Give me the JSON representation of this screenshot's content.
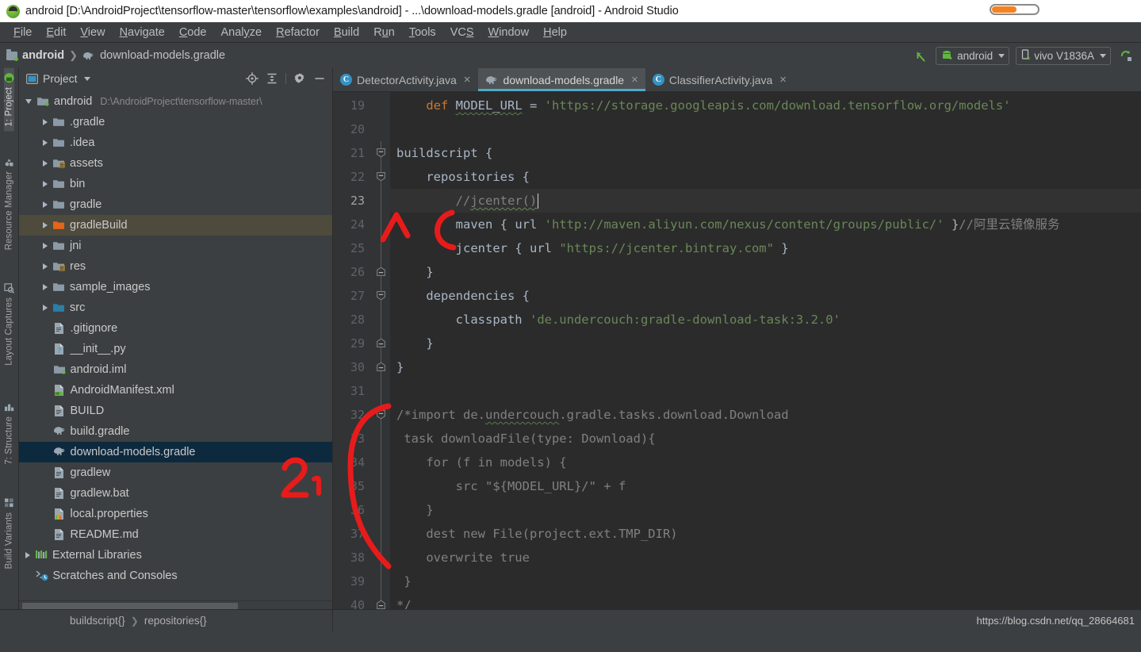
{
  "window": {
    "title": "android [D:\\AndroidProject\\tensorflow-master\\tensorflow\\examples\\android] - ...\\download-models.gradle [android] - Android Studio",
    "app_icon": "android-robot-icon",
    "progress_percent": 55
  },
  "menubar": {
    "items": [
      {
        "label": "File",
        "mnemonic": "F"
      },
      {
        "label": "Edit",
        "mnemonic": "E"
      },
      {
        "label": "View",
        "mnemonic": "V"
      },
      {
        "label": "Navigate",
        "mnemonic": "N"
      },
      {
        "label": "Code",
        "mnemonic": "C"
      },
      {
        "label": "Analyze",
        "mnemonic": "y"
      },
      {
        "label": "Refactor",
        "mnemonic": "R"
      },
      {
        "label": "Build",
        "mnemonic": "B"
      },
      {
        "label": "Run",
        "mnemonic": "u"
      },
      {
        "label": "Tools",
        "mnemonic": "T"
      },
      {
        "label": "VCS",
        "mnemonic": "S"
      },
      {
        "label": "Window",
        "mnemonic": "W"
      },
      {
        "label": "Help",
        "mnemonic": "H"
      }
    ]
  },
  "navbar": {
    "breadcrumbs": [
      {
        "label": "android",
        "icon": "module-folder-icon"
      },
      {
        "label": "download-models.gradle",
        "icon": "gradle-elephant-icon"
      }
    ],
    "run_config": {
      "label": "android",
      "icon": "android-robot-icon"
    },
    "device": {
      "label": "vivo V1836A",
      "icon": "phone-icon"
    },
    "back_arrow_icon": "back-arrow-icon",
    "sync_icon": "gradle-sync-icon"
  },
  "left_tool_strip": {
    "tabs": [
      {
        "label": "1: Project",
        "icon": "project-icon",
        "active": true
      },
      {
        "label": "Resource Manager",
        "icon": "resource-manager-icon",
        "active": false
      },
      {
        "label": "Layout Captures",
        "icon": "layout-captures-icon",
        "active": false
      },
      {
        "label": "7: Structure",
        "icon": "structure-icon",
        "active": false
      },
      {
        "label": "Build Variants",
        "icon": "build-variants-icon",
        "active": false
      }
    ]
  },
  "project_panel": {
    "title": "Project",
    "view_icon": "project-view-icon",
    "dropdown_icon": "chevron-down-icon",
    "actions": [
      {
        "name": "locate-icon"
      },
      {
        "name": "collapse-all-icon"
      },
      {
        "name": "gear-icon"
      },
      {
        "name": "minimize-icon"
      }
    ],
    "tree": [
      {
        "label": "android",
        "path": "D:\\AndroidProject\\tensorflow-master\\",
        "indent": 0,
        "arrow": "down",
        "icon": "module-folder-icon",
        "state": "normal"
      },
      {
        "label": ".gradle",
        "indent": 1,
        "arrow": "right",
        "icon": "folder-icon",
        "state": "normal"
      },
      {
        "label": ".idea",
        "indent": 1,
        "arrow": "right",
        "icon": "folder-icon",
        "state": "normal"
      },
      {
        "label": "assets",
        "indent": 1,
        "arrow": "right",
        "icon": "resource-folder-icon",
        "state": "normal"
      },
      {
        "label": "bin",
        "indent": 1,
        "arrow": "right",
        "icon": "folder-icon",
        "state": "normal"
      },
      {
        "label": "gradle",
        "indent": 1,
        "arrow": "right",
        "icon": "folder-icon",
        "state": "normal"
      },
      {
        "label": "gradleBuild",
        "indent": 1,
        "arrow": "right",
        "icon": "excluded-folder-icon",
        "state": "highlighted"
      },
      {
        "label": "jni",
        "indent": 1,
        "arrow": "right",
        "icon": "folder-icon",
        "state": "normal"
      },
      {
        "label": "res",
        "indent": 1,
        "arrow": "right",
        "icon": "resource-folder-icon",
        "state": "normal"
      },
      {
        "label": "sample_images",
        "indent": 1,
        "arrow": "right",
        "icon": "folder-icon",
        "state": "normal"
      },
      {
        "label": "src",
        "indent": 1,
        "arrow": "right",
        "icon": "source-folder-icon",
        "state": "normal"
      },
      {
        "label": ".gitignore",
        "indent": 1,
        "arrow": "none",
        "icon": "text-file-icon",
        "state": "normal"
      },
      {
        "label": "__init__.py",
        "indent": 1,
        "arrow": "none",
        "icon": "python-file-icon",
        "state": "normal"
      },
      {
        "label": "android.iml",
        "indent": 1,
        "arrow": "none",
        "icon": "module-file-icon",
        "state": "normal"
      },
      {
        "label": "AndroidManifest.xml",
        "indent": 1,
        "arrow": "none",
        "icon": "manifest-file-icon",
        "state": "normal"
      },
      {
        "label": "BUILD",
        "indent": 1,
        "arrow": "none",
        "icon": "text-file-icon",
        "state": "normal"
      },
      {
        "label": "build.gradle",
        "indent": 1,
        "arrow": "none",
        "icon": "gradle-elephant-icon",
        "state": "normal"
      },
      {
        "label": "download-models.gradle",
        "indent": 1,
        "arrow": "none",
        "icon": "gradle-elephant-icon",
        "state": "selected"
      },
      {
        "label": "gradlew",
        "indent": 1,
        "arrow": "none",
        "icon": "text-file-icon",
        "state": "normal"
      },
      {
        "label": "gradlew.bat",
        "indent": 1,
        "arrow": "none",
        "icon": "text-file-icon",
        "state": "normal"
      },
      {
        "label": "local.properties",
        "indent": 1,
        "arrow": "none",
        "icon": "properties-file-icon",
        "state": "normal"
      },
      {
        "label": "README.md",
        "indent": 1,
        "arrow": "none",
        "icon": "text-file-icon",
        "state": "normal"
      },
      {
        "label": "External Libraries",
        "indent": 0,
        "arrow": "right",
        "icon": "libraries-icon",
        "state": "normal"
      },
      {
        "label": "Scratches and Consoles",
        "indent": 0,
        "arrow": "none",
        "icon": "scratches-icon",
        "state": "normal"
      }
    ]
  },
  "editor": {
    "tabs": [
      {
        "label": "DetectorActivity.java",
        "icon": "java-class-icon",
        "active": false,
        "close_icon": "close-icon"
      },
      {
        "label": "download-models.gradle",
        "icon": "gradle-elephant-icon",
        "active": true,
        "close_icon": "close-icon"
      },
      {
        "label": "ClassifierActivity.java",
        "icon": "java-class-icon",
        "active": false,
        "close_icon": "close-icon"
      }
    ],
    "first_line_number": 19,
    "current_line": 23,
    "lines": [
      {
        "n": 19,
        "fold": "none",
        "tokens": [
          {
            "t": "    ",
            "c": "plain"
          },
          {
            "t": "def",
            "c": "kw"
          },
          {
            "t": " ",
            "c": "plain"
          },
          {
            "t": "MODEL_URL",
            "c": "wavy"
          },
          {
            "t": " = ",
            "c": "plain"
          },
          {
            "t": "'https://storage.googleapis.com/download.tensorflow.org/models'",
            "c": "str"
          }
        ]
      },
      {
        "n": 20,
        "fold": "none",
        "tokens": [
          {
            "t": "",
            "c": "plain"
          }
        ]
      },
      {
        "n": 21,
        "fold": "open",
        "tokens": [
          {
            "t": "buildscript ",
            "c": "plain"
          },
          {
            "t": "{",
            "c": "brc"
          }
        ]
      },
      {
        "n": 22,
        "fold": "open",
        "tokens": [
          {
            "t": "    repositories ",
            "c": "plain"
          },
          {
            "t": "{",
            "c": "brc"
          }
        ]
      },
      {
        "n": 23,
        "fold": "none",
        "tokens": [
          {
            "t": "        ",
            "c": "plain"
          },
          {
            "t": "//",
            "c": "cmt"
          },
          {
            "t": "jcenter()",
            "c": "cmt wavyg"
          }
        ]
      },
      {
        "n": 24,
        "fold": "none",
        "tokens": [
          {
            "t": "        maven ",
            "c": "plain"
          },
          {
            "t": "{",
            "c": "brc"
          },
          {
            "t": " url ",
            "c": "plain"
          },
          {
            "t": "'http://maven.aliyun.com/nexus/content/groups/public/'",
            "c": "str"
          },
          {
            "t": " ",
            "c": "plain"
          },
          {
            "t": "}",
            "c": "brc"
          },
          {
            "t": "//阿里云镜像服务",
            "c": "cmt"
          }
        ]
      },
      {
        "n": 25,
        "fold": "none",
        "tokens": [
          {
            "t": "        jcenter ",
            "c": "plain"
          },
          {
            "t": "{",
            "c": "brc"
          },
          {
            "t": " url ",
            "c": "plain"
          },
          {
            "t": "\"https://jcenter.bintray.com\"",
            "c": "str"
          },
          {
            "t": " ",
            "c": "plain"
          },
          {
            "t": "}",
            "c": "brc"
          }
        ]
      },
      {
        "n": 26,
        "fold": "close",
        "tokens": [
          {
            "t": "    ",
            "c": "plain"
          },
          {
            "t": "}",
            "c": "brc"
          }
        ]
      },
      {
        "n": 27,
        "fold": "open",
        "tokens": [
          {
            "t": "    dependencies ",
            "c": "plain"
          },
          {
            "t": "{",
            "c": "brc"
          }
        ]
      },
      {
        "n": 28,
        "fold": "none",
        "tokens": [
          {
            "t": "        classpath ",
            "c": "plain"
          },
          {
            "t": "'de.undercouch:gradle-download-task:3.2.0'",
            "c": "str"
          }
        ]
      },
      {
        "n": 29,
        "fold": "close",
        "tokens": [
          {
            "t": "    ",
            "c": "plain"
          },
          {
            "t": "}",
            "c": "brc"
          }
        ]
      },
      {
        "n": 30,
        "fold": "close",
        "tokens": [
          {
            "t": "}",
            "c": "brc"
          }
        ]
      },
      {
        "n": 31,
        "fold": "none",
        "tokens": [
          {
            "t": "",
            "c": "plain"
          }
        ]
      },
      {
        "n": 32,
        "fold": "open",
        "tokens": [
          {
            "t": "/*import de.",
            "c": "cmt"
          },
          {
            "t": "undercouch",
            "c": "cmt wavy"
          },
          {
            "t": ".gradle.tasks.download.Download",
            "c": "cmt"
          }
        ]
      },
      {
        "n": 33,
        "fold": "none",
        "tokens": [
          {
            "t": " task downloadFile(type: Download){",
            "c": "cmt"
          }
        ]
      },
      {
        "n": 34,
        "fold": "none",
        "tokens": [
          {
            "t": "    for (f in models) {",
            "c": "cmt"
          }
        ]
      },
      {
        "n": 35,
        "fold": "none",
        "tokens": [
          {
            "t": "        src \"${MODEL_URL}/\" + f",
            "c": "cmt"
          }
        ]
      },
      {
        "n": 36,
        "fold": "none",
        "tokens": [
          {
            "t": "    }",
            "c": "cmt"
          }
        ]
      },
      {
        "n": 37,
        "fold": "none",
        "tokens": [
          {
            "t": "    dest new File(project.ext.TMP_DIR)",
            "c": "cmt"
          }
        ]
      },
      {
        "n": 38,
        "fold": "none",
        "tokens": [
          {
            "t": "    overwrite true",
            "c": "cmt"
          }
        ]
      },
      {
        "n": 39,
        "fold": "none",
        "tokens": [
          {
            "t": " }",
            "c": "cmt"
          }
        ]
      },
      {
        "n": 40,
        "fold": "close",
        "tokens": [
          {
            "t": "*/",
            "c": "cmt"
          }
        ]
      }
    ]
  },
  "annotations": [
    {
      "label": "1",
      "color": "#e81b1b",
      "shape": "caret-and-bracket",
      "near_lines": "24-25"
    },
    {
      "label": "2",
      "color": "#e81b1b",
      "shape": "digit-two",
      "near": "download-models.gradle tree row"
    },
    {
      "label": "",
      "color": "#e81b1b",
      "shape": "big-left-bracket",
      "near_lines": "32-39"
    }
  ],
  "statusbar": {
    "breadcrumbs": [
      "buildscript{}",
      "repositories{}"
    ],
    "watermark": "https://blog.csdn.net/qq_28664681"
  },
  "colors": {
    "accent": "#4eaacb",
    "selection": "#0d293e",
    "highlight_row": "#4e4a3c",
    "annotation_red": "#e81b1b",
    "progress_orange": "#f58220",
    "chrome": "#3c3f41",
    "editor_bg": "#2b2b2b",
    "gutter_bg": "#313335"
  }
}
